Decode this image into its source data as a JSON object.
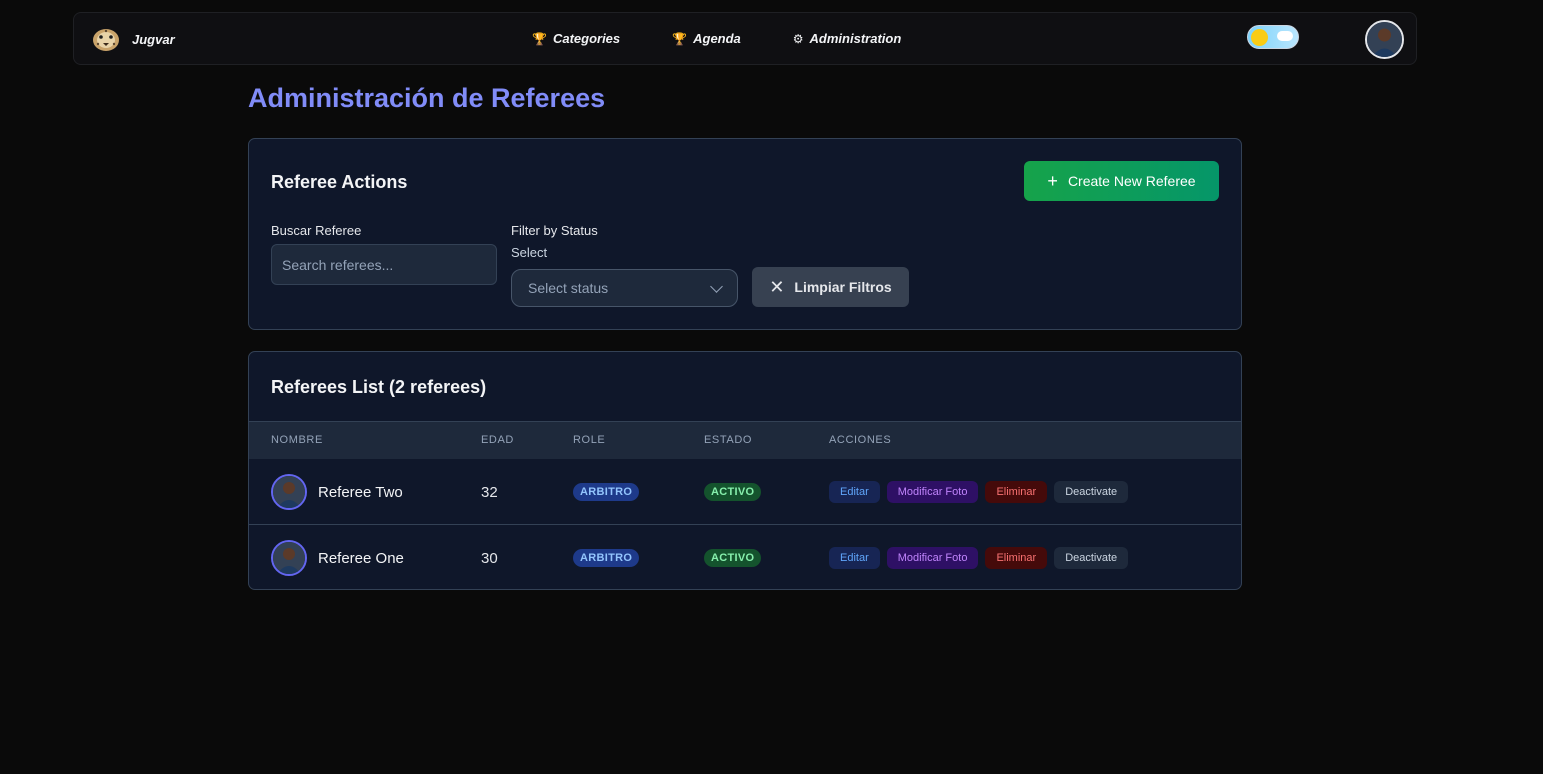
{
  "nav": {
    "brand": "Jugvar",
    "links": [
      {
        "icon": "trophy-icon",
        "label": "Categories"
      },
      {
        "icon": "trophy-icon",
        "label": "Agenda"
      },
      {
        "icon": "gear-icon",
        "label": "Administration"
      }
    ]
  },
  "page": {
    "title": "Administración de Referees"
  },
  "actions": {
    "heading": "Referee Actions",
    "create_label": "Create New Referee",
    "search_label": "Buscar Referee",
    "search_placeholder": "Search referees...",
    "search_value": "",
    "status_label": "Filter by Status",
    "status_sublabel": "Select",
    "status_placeholder": "Select status",
    "clear_label": "Limpiar Filtros"
  },
  "list": {
    "heading": "Referees List (2 referees)",
    "columns": [
      "NOMBRE",
      "EDAD",
      "ROLE",
      "ESTADO",
      "ACCIONES"
    ],
    "rows": [
      {
        "name": "Referee Two",
        "age": "32",
        "role": "ARBITRO",
        "status": "ACTIVO"
      },
      {
        "name": "Referee One",
        "age": "30",
        "role": "ARBITRO",
        "status": "ACTIVO"
      }
    ],
    "action_labels": {
      "edit": "Editar",
      "photo": "Modificar Foto",
      "delete": "Eliminar",
      "deactivate": "Deactivate"
    }
  },
  "colors": {
    "title": "#818cf8",
    "create": "#16a34a",
    "card": "#0f172a"
  }
}
